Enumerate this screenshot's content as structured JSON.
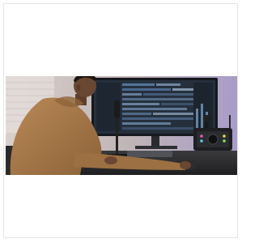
{
  "image": {
    "kind": "product-photo",
    "subject": "person-at-desk-with-microphone-and-audio-interface",
    "colors": {
      "background": "#ffffff",
      "wall": "#cfc3c0",
      "wall_right": "#a89cc8",
      "hoodie": "#a87a4c",
      "desk": "#2a2a2c",
      "monitor": "#1b1e24",
      "screen": "#2b3646",
      "accent_led": "#e85ab8"
    }
  }
}
